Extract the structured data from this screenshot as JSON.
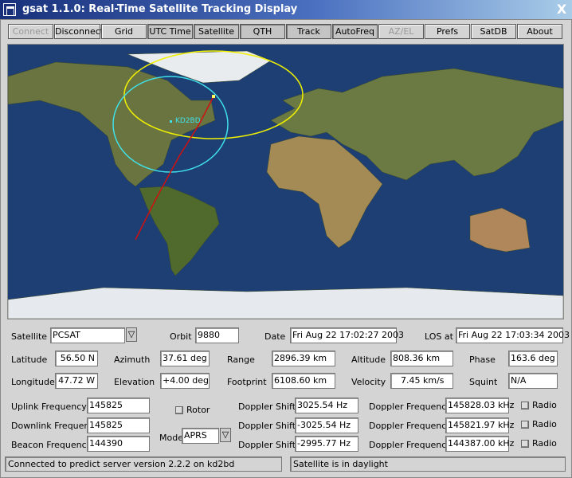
{
  "window": {
    "title": "gsat 1.1.0: Real-Time Satellite Tracking Display",
    "close": "X"
  },
  "toolbar": [
    {
      "label": "Connect",
      "state": "disabled"
    },
    {
      "label": "Disconnect",
      "state": "normal"
    },
    {
      "label": "Grid",
      "state": "normal"
    },
    {
      "label": "UTC Time",
      "state": "on"
    },
    {
      "label": "Satellite",
      "state": "on"
    },
    {
      "label": "QTH",
      "state": "on"
    },
    {
      "label": "Track",
      "state": "on"
    },
    {
      "label": "AutoFreq",
      "state": "on"
    },
    {
      "label": "AZ/EL",
      "state": "disabled"
    },
    {
      "label": "Prefs",
      "state": "normal"
    },
    {
      "label": "SatDB",
      "state": "normal"
    },
    {
      "label": "About",
      "state": "normal"
    }
  ],
  "map": {
    "qth_label": "KD2BD"
  },
  "info": {
    "satellite_label": "Satellite",
    "satellite": "PCSAT",
    "orbit_label": "Orbit",
    "orbit": "9880",
    "date_label": "Date",
    "date": "Fri Aug 22 17:02:27 2003",
    "los_label": "LOS at",
    "los": "Fri Aug 22 17:03:34 2003",
    "latitude_label": "Latitude",
    "latitude": "56.50 N",
    "azimuth_label": "Azimuth",
    "azimuth": "37.61 deg",
    "range_label": "Range",
    "range": "2896.39 km",
    "altitude_label": "Altitude",
    "altitude": "808.36 km",
    "phase_label": "Phase",
    "phase": "163.6 deg",
    "longitude_label": "Longitude",
    "longitude": "47.72 W",
    "elevation_label": "Elevation",
    "elevation": "+4.00  deg",
    "footprint_label": "Footprint",
    "footprint": "6108.60 km",
    "velocity_label": "Velocity",
    "velocity": "7.45 km/s",
    "squint_label": "Squint",
    "squint": "N/A"
  },
  "freq": {
    "uplink_label": "Uplink Frequency",
    "uplink": "145825",
    "downlink_label": "Downlink Frequency",
    "downlink": "145825",
    "beacon_label": "Beacon Frequency",
    "beacon": "144390",
    "rotor_label": "Rotor",
    "mode_label": "Mode",
    "mode": "APRS",
    "shift_label": "Doppler Shift",
    "freq_label": "Doppler Frequency",
    "radio_label": "Radio",
    "shifts": [
      "3025.54 Hz",
      "-3025.54 Hz",
      "-2995.77 Hz"
    ],
    "freqs": [
      "145828.03 kHz",
      "145821.97 kHz",
      "144387.00 kHz"
    ]
  },
  "status": {
    "left": "Connected to predict server version 2.2.2 on kd2bd",
    "right": "Satellite is in daylight"
  }
}
